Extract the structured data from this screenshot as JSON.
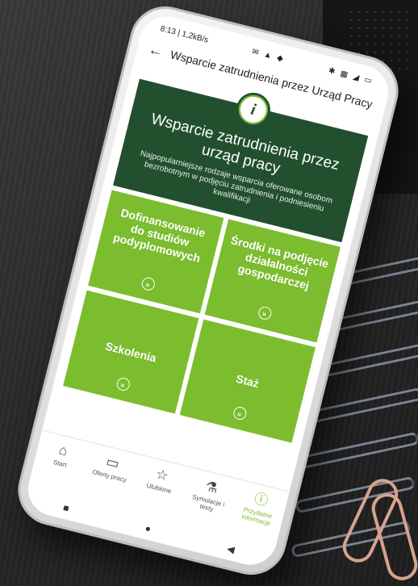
{
  "statusbar": {
    "time": "8:13 | 1,2kB/s",
    "icons": "✉ ▲ ◆",
    "right_icons": "✱ ▦ ◢ ▭"
  },
  "appbar": {
    "back_icon": "←",
    "title": "Wsparcie zatrudnienia przez Urząd Pracy"
  },
  "header": {
    "badge": "i",
    "title": "Wsparcie zatrudnienia przez urząd pracy",
    "subtitle": "Najpopularniejsze rodzaje wsparcia oferowane osobom bezrobotnym w podjęciu zatrudnienia i podniesieniu kwalifikacji"
  },
  "tiles": [
    {
      "label": "Dofinansowanie do studiów podyplomowych"
    },
    {
      "label": "Środki na podjęcie działalności gospodarczej"
    },
    {
      "label": "Szkolenia"
    },
    {
      "label": "Staż"
    }
  ],
  "arrow_glyph": "»",
  "bottom_nav": [
    {
      "label": "Start",
      "icon": "home-icon",
      "glyph": "⌂"
    },
    {
      "label": "Oferty pracy",
      "icon": "briefcase-icon",
      "glyph": "▭"
    },
    {
      "label": "Ulubione",
      "icon": "star-icon",
      "glyph": "☆"
    },
    {
      "label": "Symulacje i testy",
      "icon": "flask-icon",
      "glyph": "⚗"
    },
    {
      "label": "Przydatne informacje",
      "icon": "info-icon",
      "glyph": "ⓘ"
    }
  ],
  "system_nav": {
    "recent": "■",
    "home": "●",
    "back": "◀"
  },
  "colors": {
    "dark_green": "#22502e",
    "light_green": "#7cbd2f"
  }
}
